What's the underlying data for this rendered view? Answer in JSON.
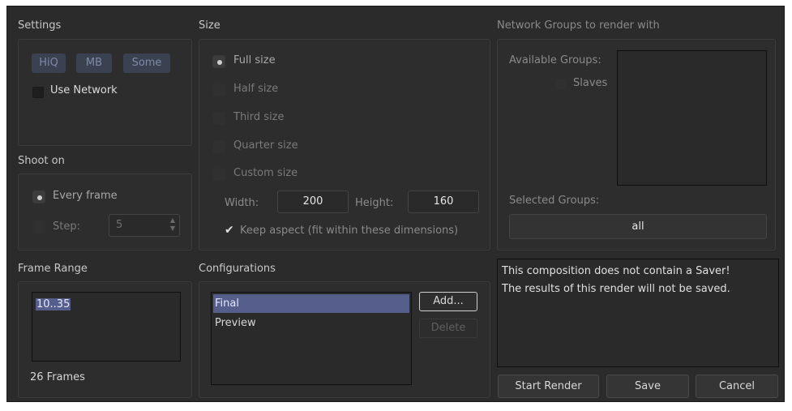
{
  "settings": {
    "title": "Settings",
    "chips": [
      "HiQ",
      "MB",
      "Some"
    ],
    "use_network_label": "Use Network"
  },
  "shoot_on": {
    "title": "Shoot on",
    "every_frame_label": "Every frame",
    "step_label": "Step:",
    "step_value": "5"
  },
  "frame_range": {
    "title": "Frame Range",
    "value": "10..35",
    "count_label": "26 Frames"
  },
  "size": {
    "title": "Size",
    "options": [
      "Full size",
      "Half size",
      "Third size",
      "Quarter size",
      "Custom size"
    ],
    "selected": "Full size",
    "width_label": "Width:",
    "width_value": "200",
    "height_label": "Height:",
    "height_value": "160",
    "keep_aspect_label": "Keep aspect (fit within these dimensions)",
    "keep_aspect_checked": true
  },
  "configurations": {
    "title": "Configurations",
    "items": [
      "Final",
      "Preview"
    ],
    "selected": "Final",
    "add_label": "Add...",
    "delete_label": "Delete"
  },
  "network": {
    "title": "Network Groups to render with",
    "available_label": "Available Groups:",
    "slaves_label": "Slaves",
    "selected_label": "Selected Groups:",
    "selected_value": "all"
  },
  "message": {
    "line1": "This composition does not contain a Saver!",
    "line2": "The results of this render will not be saved."
  },
  "actions": {
    "start_render_label": "Start Render",
    "save_label": "Save",
    "cancel_label": "Cancel"
  },
  "colors": {
    "window_bg": "#2b2b2b",
    "selection": "#565f8c",
    "chip_bg": "#3a4150"
  }
}
